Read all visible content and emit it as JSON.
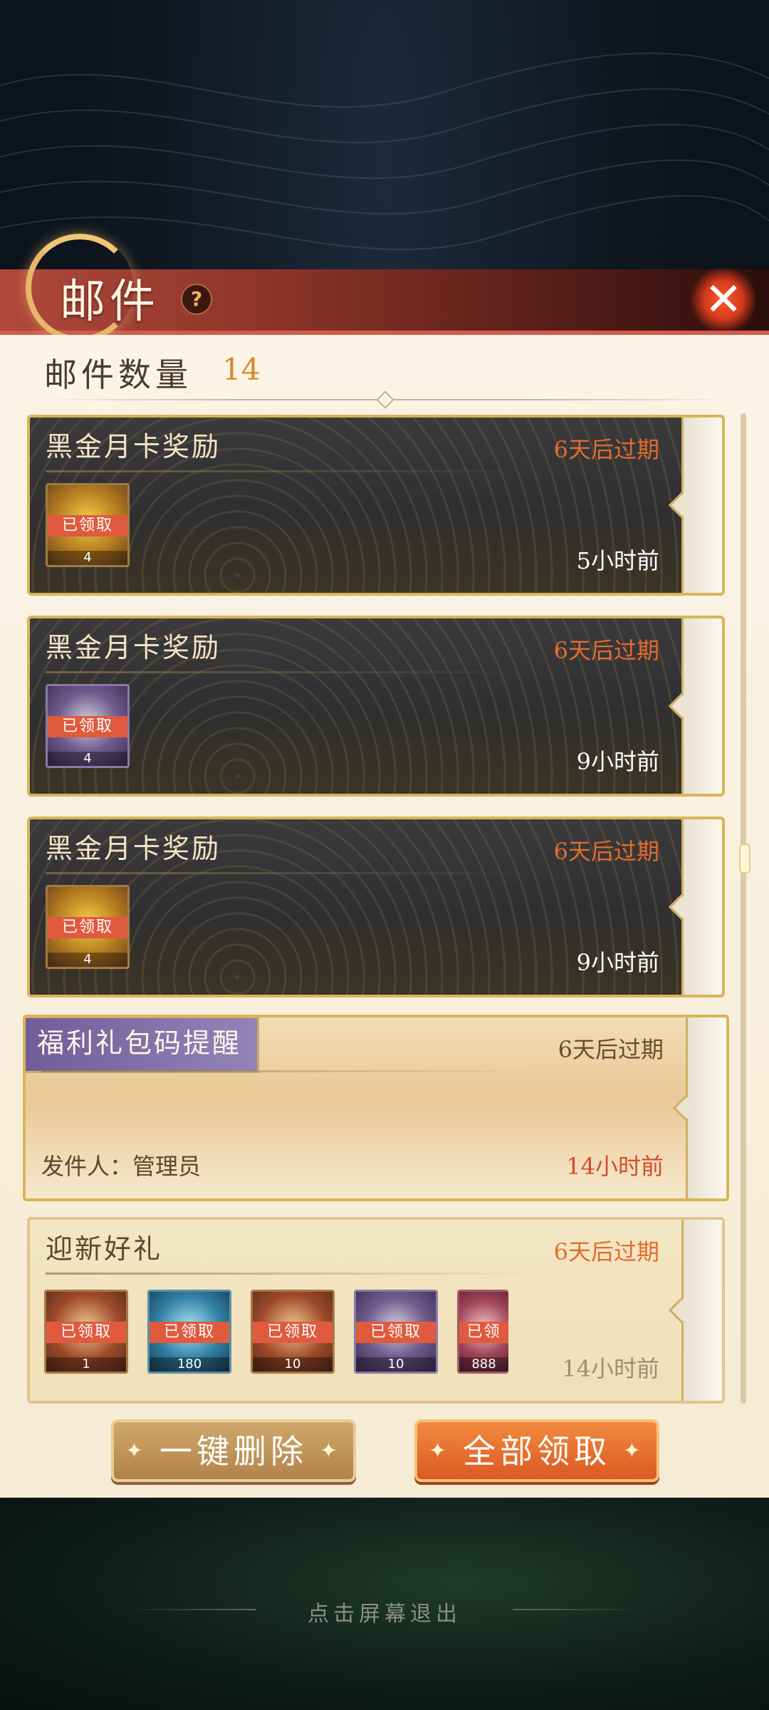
{
  "header": {
    "title": "邮件",
    "help_icon": "?",
    "close_icon": "✕"
  },
  "summary": {
    "count_label": "邮件数量",
    "count_value": "14"
  },
  "mails": [
    {
      "title": "黑金月卡奖励",
      "expire": "6天后过期",
      "time": "5小时前",
      "items": [
        {
          "icon": "gold-ingot-icon",
          "status": "已领取",
          "qty": "4"
        }
      ]
    },
    {
      "title": "黑金月卡奖励",
      "expire": "6天后过期",
      "time": "9小时前",
      "items": [
        {
          "icon": "scroll-icon",
          "status": "已领取",
          "qty": "4"
        }
      ]
    },
    {
      "title": "黑金月卡奖励",
      "expire": "6天后过期",
      "time": "9小时前",
      "items": [
        {
          "icon": "gold-ingot-icon",
          "status": "已领取",
          "qty": "4"
        }
      ]
    },
    {
      "title": "福利礼包码提醒",
      "expire": "6天后过期",
      "time": "14小时前",
      "sender": "发件人：管理员"
    },
    {
      "title": "迎新好礼",
      "expire": "6天后过期",
      "time": "14小时前",
      "items": [
        {
          "icon": "treasure-chest-icon",
          "status": "已领取",
          "qty": "1"
        },
        {
          "icon": "crystal-icon",
          "status": "已领取",
          "qty": "180"
        },
        {
          "icon": "scroll-icon",
          "status": "已领取",
          "qty": "10"
        },
        {
          "icon": "scroll-icon",
          "status": "已领取",
          "qty": "10"
        },
        {
          "icon": "gem-icon",
          "status": "已领",
          "qty": "888"
        }
      ]
    }
  ],
  "buttons": {
    "delete_all": "一键删除",
    "claim_all": "全部领取"
  },
  "footer": {
    "exit_hint": "点击屏幕退出"
  },
  "colors": {
    "accent_orange": "#e46b2d",
    "banner_red": "#b0493b",
    "claimed_red": "#e05a3d",
    "card_gold": "#d9b45a"
  }
}
